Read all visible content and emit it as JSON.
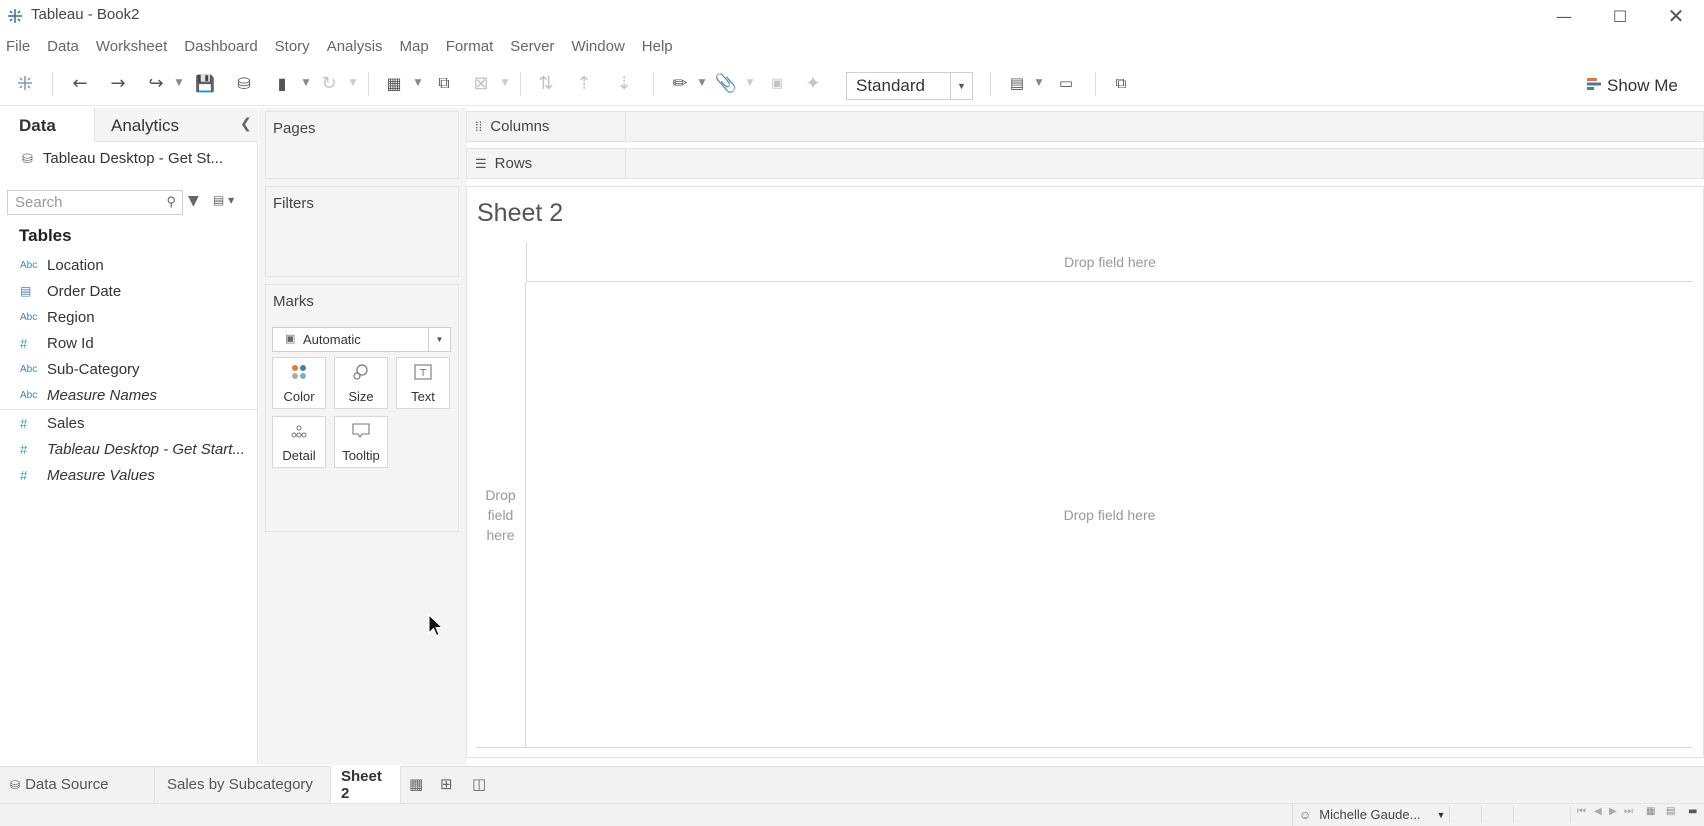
{
  "window": {
    "title": "Tableau - Book2",
    "app_icon": "tableau-logo-icon",
    "controls": [
      "minimize-icon",
      "maximize-icon",
      "close-icon"
    ]
  },
  "menu": [
    "File",
    "Data",
    "Worksheet",
    "Dashboard",
    "Story",
    "Analysis",
    "Map",
    "Format",
    "Server",
    "Window",
    "Help"
  ],
  "toolbar": {
    "fit_select": "Standard",
    "show_me": "Show Me",
    "icons": [
      "tableau-logo-icon",
      "undo-icon",
      "redo-icon",
      "replay-icon",
      "save-icon",
      "new-datasource-icon",
      "pause-updates-icon",
      "refresh-icon",
      "new-worksheet-icon",
      "duplicate-icon",
      "clear-sheet-icon",
      "swap-icon",
      "sort-ascending-icon",
      "sort-descending-icon",
      "highlight-icon",
      "group-icon",
      "labels-icon",
      "pin-icon",
      "fit-icon",
      "presentation-icon",
      "share-icon"
    ]
  },
  "data_pane": {
    "tabs": {
      "data": "Data",
      "analytics": "Analytics"
    },
    "datasource": "Tableau Desktop - Get St...",
    "search_placeholder": "Search",
    "tables_heading": "Tables",
    "fields": [
      {
        "icon": "Abc",
        "label": "Location",
        "italic": false
      },
      {
        "icon": "calendar",
        "label": "Order Date",
        "italic": false
      },
      {
        "icon": "Abc",
        "label": "Region",
        "italic": false
      },
      {
        "icon": "#",
        "label": "Row Id",
        "italic": false
      },
      {
        "icon": "Abc",
        "label": "Sub-Category",
        "italic": false
      },
      {
        "icon": "Abc",
        "label": "Measure Names",
        "italic": true
      },
      {
        "icon": "#",
        "label": "Sales",
        "italic": false
      },
      {
        "icon": "#",
        "label": "Tableau Desktop - Get Start...",
        "italic": true
      },
      {
        "icon": "#",
        "label": "Measure Values",
        "italic": true
      }
    ]
  },
  "cards": {
    "pages": "Pages",
    "filters": "Filters",
    "marks": "Marks",
    "mark_type": "Automatic",
    "mark_buttons": [
      "Color",
      "Size",
      "Text",
      "Detail",
      "Tooltip"
    ]
  },
  "shelves": {
    "columns": "Columns",
    "rows": "Rows"
  },
  "view": {
    "sheet_title": "Sheet 2",
    "drop_top": "Drop field here",
    "drop_left": "Drop field here",
    "drop_main": "Drop field here"
  },
  "sheet_tabs": {
    "data_source": "Data Source",
    "tabs": [
      "Sales by Subcategory",
      "Sheet 2"
    ],
    "active": "Sheet 2"
  },
  "status": {
    "user": "Michelle Gaude..."
  }
}
